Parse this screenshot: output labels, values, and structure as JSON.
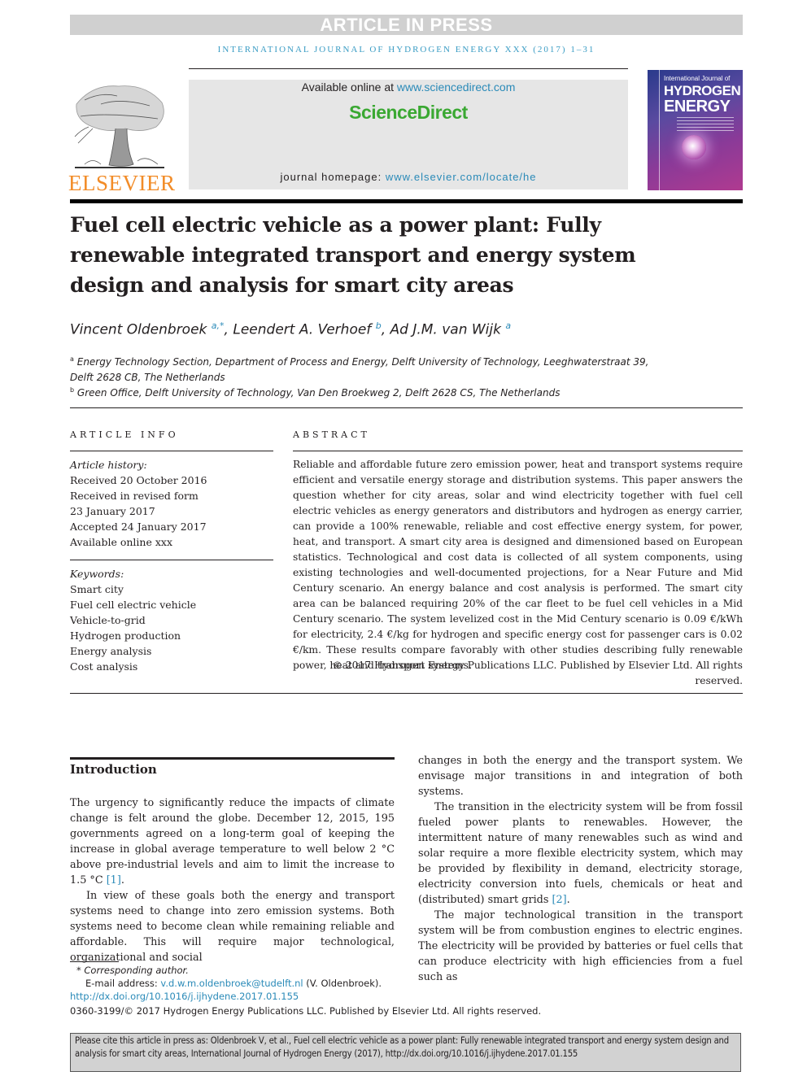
{
  "banner": {
    "label": "ARTICLE IN PRESS"
  },
  "running_header": "INTERNATIONAL JOURNAL OF HYDROGEN ENERGY XXX (2017) 1–31",
  "publisher": {
    "logo_text": "ELSEVIER",
    "available_prefix": "Available online at ",
    "available_link": "www.sciencedirect.com",
    "platform_name": "ScienceDirect",
    "homepage_prefix": "journal homepage: ",
    "homepage_link": "www.elsevier.com/locate/he",
    "brand_colors": {
      "elsevier_orange": "#f28c28",
      "sciencedirect_green": "#3aa832",
      "link_blue": "#2a8ab8"
    }
  },
  "journal_cover": {
    "line1": "International Journal of",
    "line2": "HYDROGEN",
    "line3": "ENERGY"
  },
  "article": {
    "title": "Fuel cell electric vehicle as a power plant: Fully renewable integrated transport and energy system design and analysis for smart city areas",
    "authors": [
      {
        "name": "Vincent Oldenbroek",
        "sup": "a,*"
      },
      {
        "name": "Leendert A. Verhoef",
        "sup": "b"
      },
      {
        "name": "Ad J.M. van Wijk",
        "sup": "a"
      }
    ],
    "affiliations": [
      {
        "mark": "a",
        "text": "Energy Technology Section, Department of Process and Energy, Delft University of Technology, Leeghwaterstraat 39, Delft 2628 CB, The Netherlands"
      },
      {
        "mark": "b",
        "text": "Green Office, Delft University of Technology, Van Den Broekweg 2, Delft 2628 CS, The Netherlands"
      }
    ]
  },
  "article_info": {
    "heading": "ARTICLE INFO",
    "history_label": "Article history:",
    "history": [
      "Received 20 October 2016",
      "Received in revised form",
      "23 January 2017",
      "Accepted 24 January 2017",
      "Available online xxx"
    ],
    "keywords_label": "Keywords:",
    "keywords": [
      "Smart city",
      "Fuel cell electric vehicle",
      "Vehicle-to-grid",
      "Hydrogen production",
      "Energy analysis",
      "Cost analysis"
    ]
  },
  "abstract": {
    "heading": "ABSTRACT",
    "text": "Reliable and affordable future zero emission power, heat and transport systems require efficient and versatile energy storage and distribution systems. This paper answers the question whether for city areas, solar and wind electricity together with fuel cell electric vehicles as energy generators and distributors and hydrogen as energy carrier, can provide a 100% renewable, reliable and cost effective energy system, for power, heat, and transport. A smart city area is designed and dimensioned based on European statistics. Technological and cost data is collected of all system components, using existing technologies and well-documented projections, for a Near Future and Mid Century scenario. An energy balance and cost analysis is performed. The smart city area can be balanced requiring 20% of the car fleet to be fuel cell vehicles in a Mid Century scenario. The system levelized cost in the Mid Century scenario is 0.09 €/kWh for electricity, 2.4 €/kg for hydrogen and specific energy cost for passenger cars is 0.02 €/km. These results compare favorably with other studies describing fully renewable power, heat and transport systems.",
    "copyright": "© 2017 Hydrogen Energy Publications LLC. Published by Elsevier Ltd. All rights reserved."
  },
  "introduction": {
    "heading": "Introduction",
    "left_paragraphs": [
      {
        "text": "The urgency to significantly reduce the impacts of climate change is felt around the globe. December 12, 2015, 195 governments agreed on a long-term goal of keeping the increase in global average temperature to well below 2 °C above pre-industrial levels and aim to limit the increase to 1.5 °C ",
        "ref": "[1]",
        "after": "."
      },
      {
        "text": "In view of these goals both the energy and transport systems need to change into zero emission systems. Both systems need to become clean while remaining reliable and affordable. This will require major technological, organizational and social"
      }
    ],
    "right_paragraphs": [
      {
        "text": "changes in both the energy and the transport system. We envisage major transitions in and integration of both systems."
      },
      {
        "text": "The transition in the electricity system will be from fossil fueled power plants to renewables. However, the intermittent nature of many renewables such as wind and solar require a more flexible electricity system, which may be provided by flexibility in demand, electricity storage, electricity conversion into fuels, chemicals or heat and (distributed) smart grids ",
        "ref": "[2]",
        "after": "."
      },
      {
        "text": "The major technological transition in the transport system will be from combustion engines to electric engines. The electricity will be provided by batteries or fuel cells that can produce electricity with high efficiencies from a fuel such as"
      }
    ]
  },
  "footnotes": {
    "corresponding_mark": "*",
    "corresponding_label": "Corresponding author.",
    "email_label": "E-mail address: ",
    "email": "v.d.w.m.oldenbroek@tudelft.nl",
    "email_owner": " (V. Oldenbroek).",
    "doi": "http://dx.doi.org/10.1016/j.ijhydene.2017.01.155",
    "issn_copyright": "0360-3199/© 2017 Hydrogen Energy Publications LLC. Published by Elsevier Ltd. All rights reserved."
  },
  "citation_box": {
    "text": "Please cite this article in press as: Oldenbroek V, et al., Fuel cell electric vehicle as a power plant: Fully renewable integrated transport and energy system design and analysis for smart city areas, International Journal of Hydrogen Energy (2017), http://dx.doi.org/10.1016/j.ijhydene.2017.01.155"
  }
}
